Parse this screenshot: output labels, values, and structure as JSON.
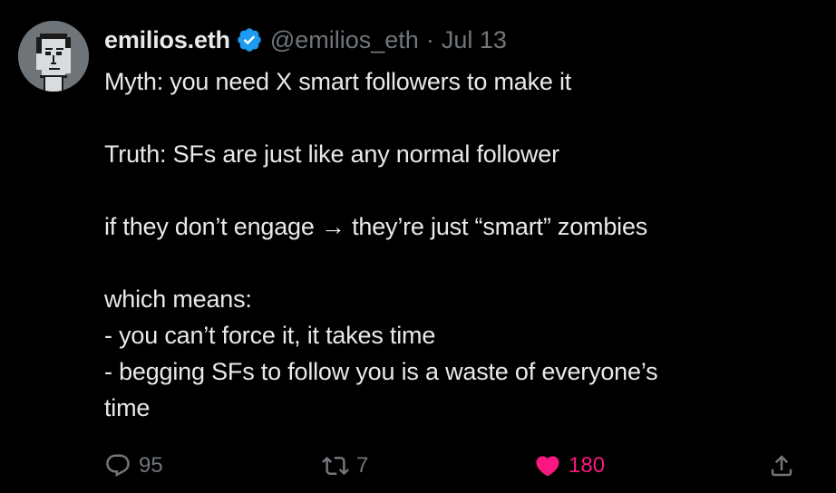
{
  "tweet": {
    "author_name": "emilios.eth",
    "handle": "@emilios_eth",
    "separator": "·",
    "date": "Jul 13",
    "lines": [
      "Myth: you need X smart followers to make it",
      "",
      "Truth: SFs are just like any normal follower",
      "",
      "if they don’t engage → they’re just “smart” zombies",
      "",
      "which means:",
      "- you can’t force it, it takes time",
      "- begging SFs to follow you is a waste of everyone’s",
      "time"
    ]
  },
  "actions": {
    "replies": "95",
    "retweets": "7",
    "likes": "180"
  },
  "colors": {
    "background": "#000000",
    "text": "#e7e9ea",
    "muted": "#71767b",
    "verified": "#1d9bf0",
    "like": "#f91880"
  },
  "icons": [
    "avatar",
    "verified-badge-icon",
    "reply-icon",
    "retweet-icon",
    "heart-icon",
    "share-icon"
  ]
}
